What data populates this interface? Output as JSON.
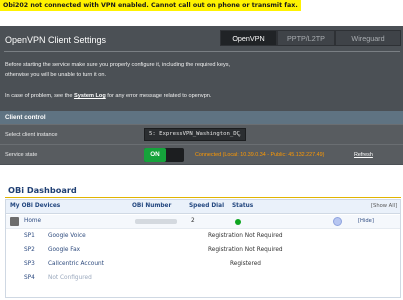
{
  "notice": "Obi202 not connected with VPN enabled.  Cannot call out on phone or transmit fax.",
  "vpn": {
    "title": "OpenVPN Client Settings",
    "tabs": [
      {
        "label": "OpenVPN",
        "active": true
      },
      {
        "label": "PPTP/L2TP",
        "active": false
      },
      {
        "label": "Wireguard",
        "active": false
      }
    ],
    "desc_line1": "Before starting the service make sure you properly configure it, including the required keys,",
    "desc_line2": "otherwise you will be unable to turn it on.",
    "desc_line3_pre": "In case of problem, see the ",
    "desc_line3_link": "System Log",
    "desc_line3_post": " for any error message related to openvpn.",
    "section_title": "Client control",
    "select_label": "Select client instance",
    "select_value": "5: ExpressVPN_Washington_DC",
    "state_label": "Service state",
    "toggle_label": "ON",
    "state_text": "Connected (Local: 10.39.0.34 - Public: 45.132.227.49)",
    "refresh_label": "Refresh"
  },
  "obi": {
    "title": "OBi Dashboard",
    "columns": {
      "devices": "My OBi Devices",
      "number": "OBi Number",
      "speed_dial": "Speed Dial",
      "status": "Status",
      "show_all": "[Show All]"
    },
    "device": {
      "name": "Home",
      "speed_dial": "2",
      "status_color": "#0fa521",
      "hide_label": "[Hide]"
    },
    "service_providers": [
      {
        "id": "SP1",
        "name": "Google Voice",
        "status": "Registration Not Required"
      },
      {
        "id": "SP2",
        "name": "Google Fax",
        "status": "Registration Not Required"
      },
      {
        "id": "SP3",
        "name": "Callcentric Account",
        "status": "Registered"
      },
      {
        "id": "SP4",
        "name": "Not Configured",
        "status": ""
      }
    ]
  }
}
